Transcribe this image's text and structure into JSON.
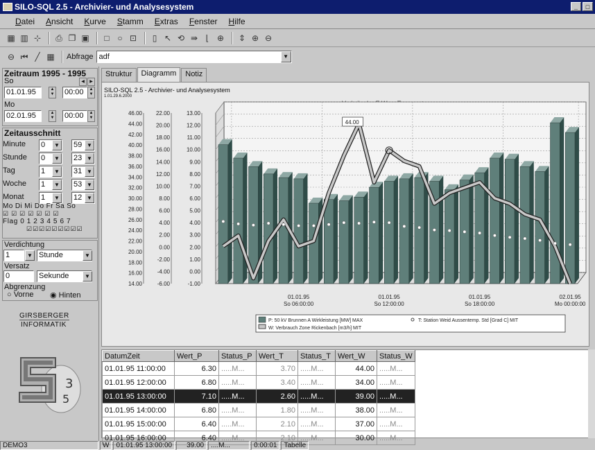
{
  "window": {
    "title": "SILO-SQL 2.5 - Archivier- und Analysesystem",
    "controls": [
      "_",
      "□"
    ]
  },
  "menu": [
    "Datei",
    "Ansicht",
    "Kurve",
    "Stamm",
    "Extras",
    "Fenster",
    "Hilfe"
  ],
  "toolbar2": {
    "query_label": "Abfrage",
    "query_value": "adf"
  },
  "left": {
    "zeitraum_title": "Zeitraum 1995 - 1995",
    "day1": "So",
    "date1": "01.01.95",
    "time1": "00:00",
    "day2": "Mo",
    "date2": "02.01.95",
    "time2": "00:00",
    "zeitausschnitt_title": "Zeitausschnitt",
    "rows": [
      {
        "label": "Minute",
        "from": "0",
        "to": "59"
      },
      {
        "label": "Stunde",
        "from": "0",
        "to": "23"
      },
      {
        "label": "Tag",
        "from": "1",
        "to": "31"
      },
      {
        "label": "Woche",
        "from": "1",
        "to": "53"
      },
      {
        "label": "Monat",
        "from": "1",
        "to": "12"
      }
    ],
    "weekdays": "Mo Di Mi Do Fr Sa So",
    "flags": "Flag 0 1 2 3 4 5 6 7",
    "verdichtung_title": "Verdichtung",
    "verdichtung_val": "1",
    "verdichtung_unit": "Stunde",
    "versatz_title": "Versatz",
    "versatz_val": "0",
    "versatz_unit": "Sekunde",
    "abgrenzung_title": "Abgrenzung",
    "opt_vorne": "Vorne",
    "opt_hinten": "Hinten",
    "brand1": "GIRSBERGER",
    "brand2": "INFORMATIK"
  },
  "tabs": [
    "Struktur",
    "Diagramm",
    "Notiz"
  ],
  "chart_header": {
    "app": "SILO-SQL 2.5 - Archivier- und Analysesystem",
    "date": "1.01.29.6.2000"
  },
  "chart_data": {
    "type": "bar",
    "title": "Verbräuche E,W zu Temperatur",
    "x_tick_labels": [
      [
        "01.01.95",
        "So 06:00:00"
      ],
      [
        "01.01.95",
        "So 12:00:00"
      ],
      [
        "01.01.95",
        "So 18:00:00"
      ],
      [
        "02.01.95",
        "Mo 00:00:00"
      ]
    ],
    "axis_W": {
      "ticks": [
        "46.00",
        "44.00",
        "42.00",
        "40.00",
        "38.00",
        "36.00",
        "34.00",
        "32.00",
        "30.00",
        "28.00",
        "26.00",
        "24.00",
        "22.00",
        "20.00",
        "18.00",
        "16.00",
        "14.00"
      ],
      "range": [
        14,
        46
      ]
    },
    "axis_T": {
      "ticks": [
        "22.00",
        "20.00",
        "18.00",
        "16.00",
        "14.00",
        "12.00",
        "10.00",
        "8.00",
        "6.00",
        "4.00",
        "2.00",
        "0.00",
        "-2.00",
        "-4.00",
        "-6.00"
      ],
      "range": [
        -6,
        22
      ]
    },
    "axis_P": {
      "ticks": [
        "13.00",
        "12.00",
        "11.00",
        "10.00",
        "9.00",
        "8.00",
        "7.00",
        "6.00",
        "5.00",
        "4.00",
        "3.00",
        "2.00",
        "1.00",
        "0.00",
        "-1.00"
      ],
      "range": [
        -1,
        13
      ]
    },
    "annotation": "44.00",
    "series": [
      {
        "name": "P: 50 kV Brunnen A  Wirkleistung [MW]  MAX",
        "axis": "P",
        "type": "bar",
        "values": [
          10.4,
          9.3,
          8.6,
          8.0,
          7.7,
          7.6,
          5.6,
          5.9,
          5.8,
          6.1,
          6.9,
          7.4,
          7.6,
          7.7,
          7.4,
          6.7,
          7.5,
          8.1,
          9.3,
          9.2,
          8.6,
          8.2,
          12.2,
          11.4
        ]
      },
      {
        "name": "T: Station Weid Aussentemp. Std [Grad C]  MIT",
        "axis": "T",
        "type": "scatter",
        "values": [
          4.2,
          3.8,
          3.6,
          3.9,
          3.7,
          3.5,
          3.5,
          3.7,
          4.0,
          3.9,
          4.1,
          4.0,
          3.4,
          3.2,
          2.8,
          2.7,
          2.5,
          2.3,
          1.9,
          1.6,
          1.4,
          1.1,
          0.6,
          0.4
        ]
      },
      {
        "name": "W: Verbrauch Zone Rickenbach [m3/h]  MIT",
        "axis": "W",
        "type": "line",
        "values": [
          21,
          23,
          15,
          22,
          26,
          21,
          22,
          31,
          38,
          44,
          33,
          39,
          37,
          36,
          29,
          31,
          32,
          33,
          30,
          29,
          27,
          26,
          21,
          14
        ]
      }
    ]
  },
  "table": {
    "headers": [
      "DatumZeit",
      "Wert_P",
      "Status_P",
      "Wert_T",
      "Status_T",
      "Wert_W",
      "Status_W"
    ],
    "rows": [
      [
        "01.01.95 11:00:00",
        "6.30",
        ".....M...",
        "3.70",
        ".....M...",
        "44.00",
        ".....M..."
      ],
      [
        "01.01.95 12:00:00",
        "6.80",
        ".....M...",
        "3.40",
        ".....M...",
        "34.00",
        ".....M..."
      ],
      [
        "01.01.95 13:00:00",
        "7.10",
        ".....M...",
        "2.60",
        ".....M...",
        "39.00",
        ".....M..."
      ],
      [
        "01.01.95 14:00:00",
        "6.80",
        ".....M...",
        "1.80",
        ".....M...",
        "38.00",
        ".....M..."
      ],
      [
        "01.01.95 15:00:00",
        "6.40",
        ".....M...",
        "2.10",
        ".....M...",
        "37.00",
        ".....M..."
      ],
      [
        "01.01.95 16:00:00",
        "6.40",
        ".....M...",
        "2.10",
        ".....M...",
        "30.00",
        ".....M..."
      ]
    ],
    "selected_row": 2
  },
  "statusbar": [
    "DEMO3",
    "W",
    "01.01.95 13:00:00",
    "39.00",
    "....M...",
    "0:00:01",
    "Tabelle"
  ]
}
